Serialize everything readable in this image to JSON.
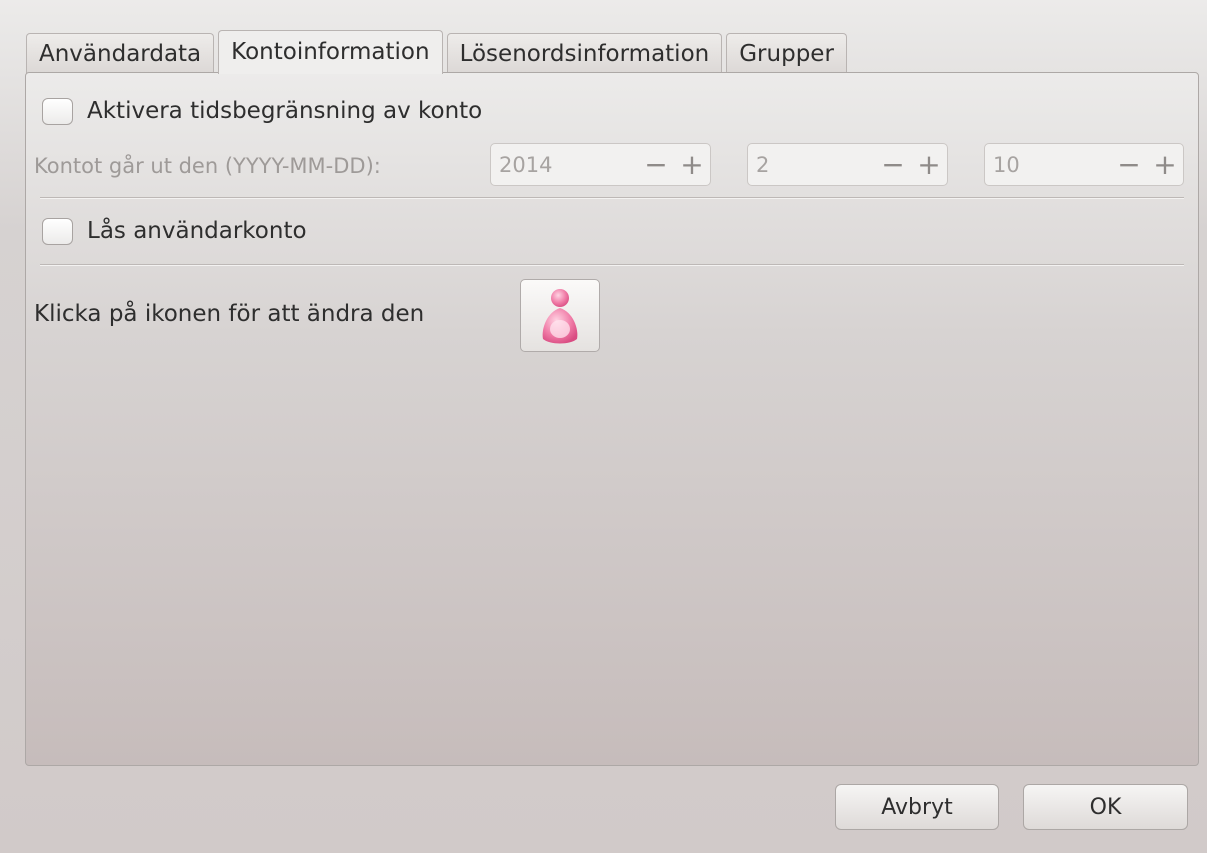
{
  "tabs": [
    {
      "label": "Användardata",
      "active": false
    },
    {
      "label": "Kontoinformation",
      "active": true
    },
    {
      "label": "Lösenordsinformation",
      "active": false
    },
    {
      "label": "Grupper",
      "active": false
    }
  ],
  "account": {
    "expire_checkbox_label": "Aktivera tidsbegränsning av konto",
    "expire_checked": false,
    "date_label": "Kontot går ut den (YYYY-MM-DD):",
    "year": "2014",
    "month": "2",
    "day": "10",
    "minus": "−",
    "plus": "+",
    "lock_checkbox_label": "Lås användarkonto",
    "lock_checked": false,
    "icon_label": "Klicka på ikonen för att ändra den",
    "icon_name": "user-avatar-icon",
    "icon_color": "#e96a9a"
  },
  "buttons": {
    "cancel": "Avbryt",
    "ok": "OK"
  }
}
